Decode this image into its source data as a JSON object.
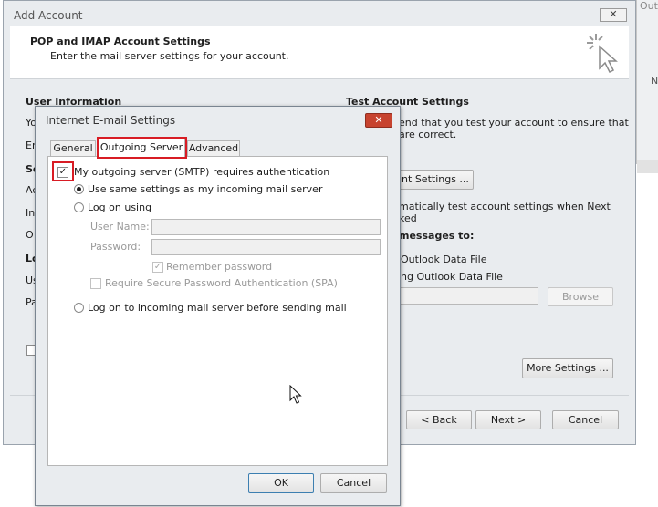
{
  "background_window": {
    "right_edge_fragments": [
      "Outl",
      "N"
    ]
  },
  "add_account": {
    "title": "Add Account",
    "header": {
      "title": "POP and IMAP Account Settings",
      "subtitle": "Enter the mail server settings for your account."
    },
    "left_labels": [
      "User Information",
      "Yo",
      "En",
      "Se",
      "Ac",
      "In",
      "O",
      "Lo",
      "Us",
      "Pa"
    ],
    "test_section": {
      "heading": "Test Account Settings",
      "line1": "end that you test your account to ensure that",
      "line2": "are correct.",
      "test_button": "unt Settings ...",
      "auto_line1": "matically test account settings when Next",
      "auto_line2": "ked",
      "deliver_heading": "messages to:",
      "option1": "Outlook Data File",
      "option2": "ng Outlook Data File",
      "browse_button": "Browse"
    },
    "more_settings_button": "More Settings ...",
    "back_button": "< Back",
    "next_button": "Next >",
    "cancel_button": "Cancel"
  },
  "dialog": {
    "title": "Internet E-mail Settings",
    "tabs": [
      {
        "label": "General",
        "selected": false
      },
      {
        "label": "Outgoing Server",
        "selected": true
      },
      {
        "label": "Advanced",
        "selected": false
      }
    ],
    "requires_auth": {
      "label": "My outgoing server (SMTP) requires authentication",
      "checked": true
    },
    "use_same": {
      "label": "Use same settings as my incoming mail server",
      "selected": true
    },
    "log_on_using": {
      "label": "Log on using",
      "selected": false
    },
    "username_label": "User Name:",
    "username_value": "",
    "password_label": "Password:",
    "password_value": "",
    "remember_password": {
      "label": "Remember password",
      "checked": true
    },
    "spa": {
      "label": "Require Secure Password Authentication (SPA)",
      "checked": false
    },
    "log_on_incoming": {
      "label": "Log on to incoming mail server before sending mail",
      "selected": false
    },
    "ok_button": "OK",
    "cancel_button": "Cancel"
  },
  "colors": {
    "highlight_red": "#d81c24",
    "close_button_red": "#c7432f",
    "window_frame": "#e9ecef"
  }
}
